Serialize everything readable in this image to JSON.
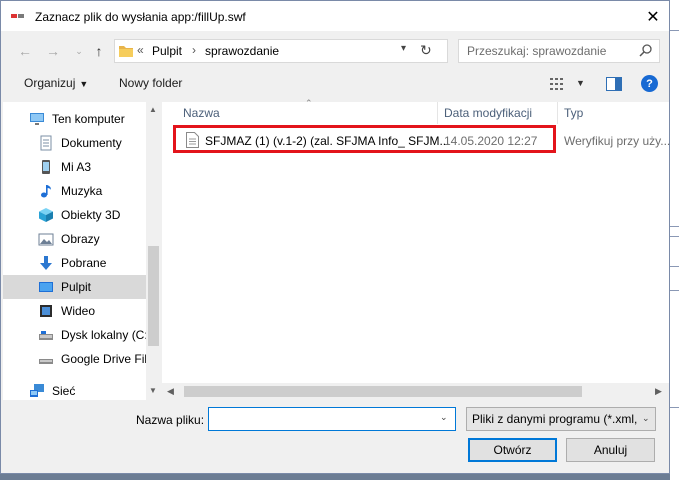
{
  "window": {
    "title": "Zaznacz plik do wysłania app:/fillUp.swf",
    "close_glyph": "✕"
  },
  "navigation": {
    "back_glyph": "←",
    "forward_glyph": "→",
    "up_glyph": "↑",
    "breadcrumb_prefix": "«",
    "breadcrumb": [
      "Pulpit",
      "sprawozdanie"
    ],
    "separator": "›"
  },
  "search": {
    "placeholder": "Przeszukaj: sprawozdanie"
  },
  "toolbar": {
    "organize_label": "Organizuj",
    "new_folder_label": "Nowy folder"
  },
  "sidebar": {
    "items": [
      {
        "label": "Ten komputer",
        "icon": "computer-icon"
      },
      {
        "label": "Dokumenty",
        "icon": "documents-icon"
      },
      {
        "label": "Mi A3",
        "icon": "phone-icon"
      },
      {
        "label": "Muzyka",
        "icon": "music-icon"
      },
      {
        "label": "Obiekty 3D",
        "icon": "cube-3d-icon"
      },
      {
        "label": "Obrazy",
        "icon": "pictures-icon"
      },
      {
        "label": "Pobrane",
        "icon": "download-icon"
      },
      {
        "label": "Pulpit",
        "icon": "desktop-icon",
        "selected": true
      },
      {
        "label": "Wideo",
        "icon": "video-icon"
      },
      {
        "label": "Dysk lokalny (C:)",
        "icon": "drive-icon"
      },
      {
        "label": "Google Drive File",
        "icon": "drive-icon"
      },
      {
        "label": "Sieć",
        "icon": "network-icon"
      }
    ]
  },
  "file_list": {
    "columns": [
      "Nazwa",
      "Data modyfikacji",
      "Typ"
    ],
    "rows": [
      {
        "name": "SFJMAZ (1) (v.1-2) (zal. SFJMA Info_ SFJM...",
        "date": "14.05.2020 12:27",
        "type": "Weryfikuj przy uży...",
        "icon": "document-icon",
        "highlighted": true
      }
    ]
  },
  "bottom": {
    "filename_label": "Nazwa pliku:",
    "filename_value": "",
    "filter_value": "Pliki z danymi programu (*.xml,",
    "open_label": "Otwórz",
    "cancel_label": "Anuluj"
  },
  "colors": {
    "accent": "#0078d7",
    "highlight": "#e3141b",
    "selection": "#d9d9d9"
  }
}
